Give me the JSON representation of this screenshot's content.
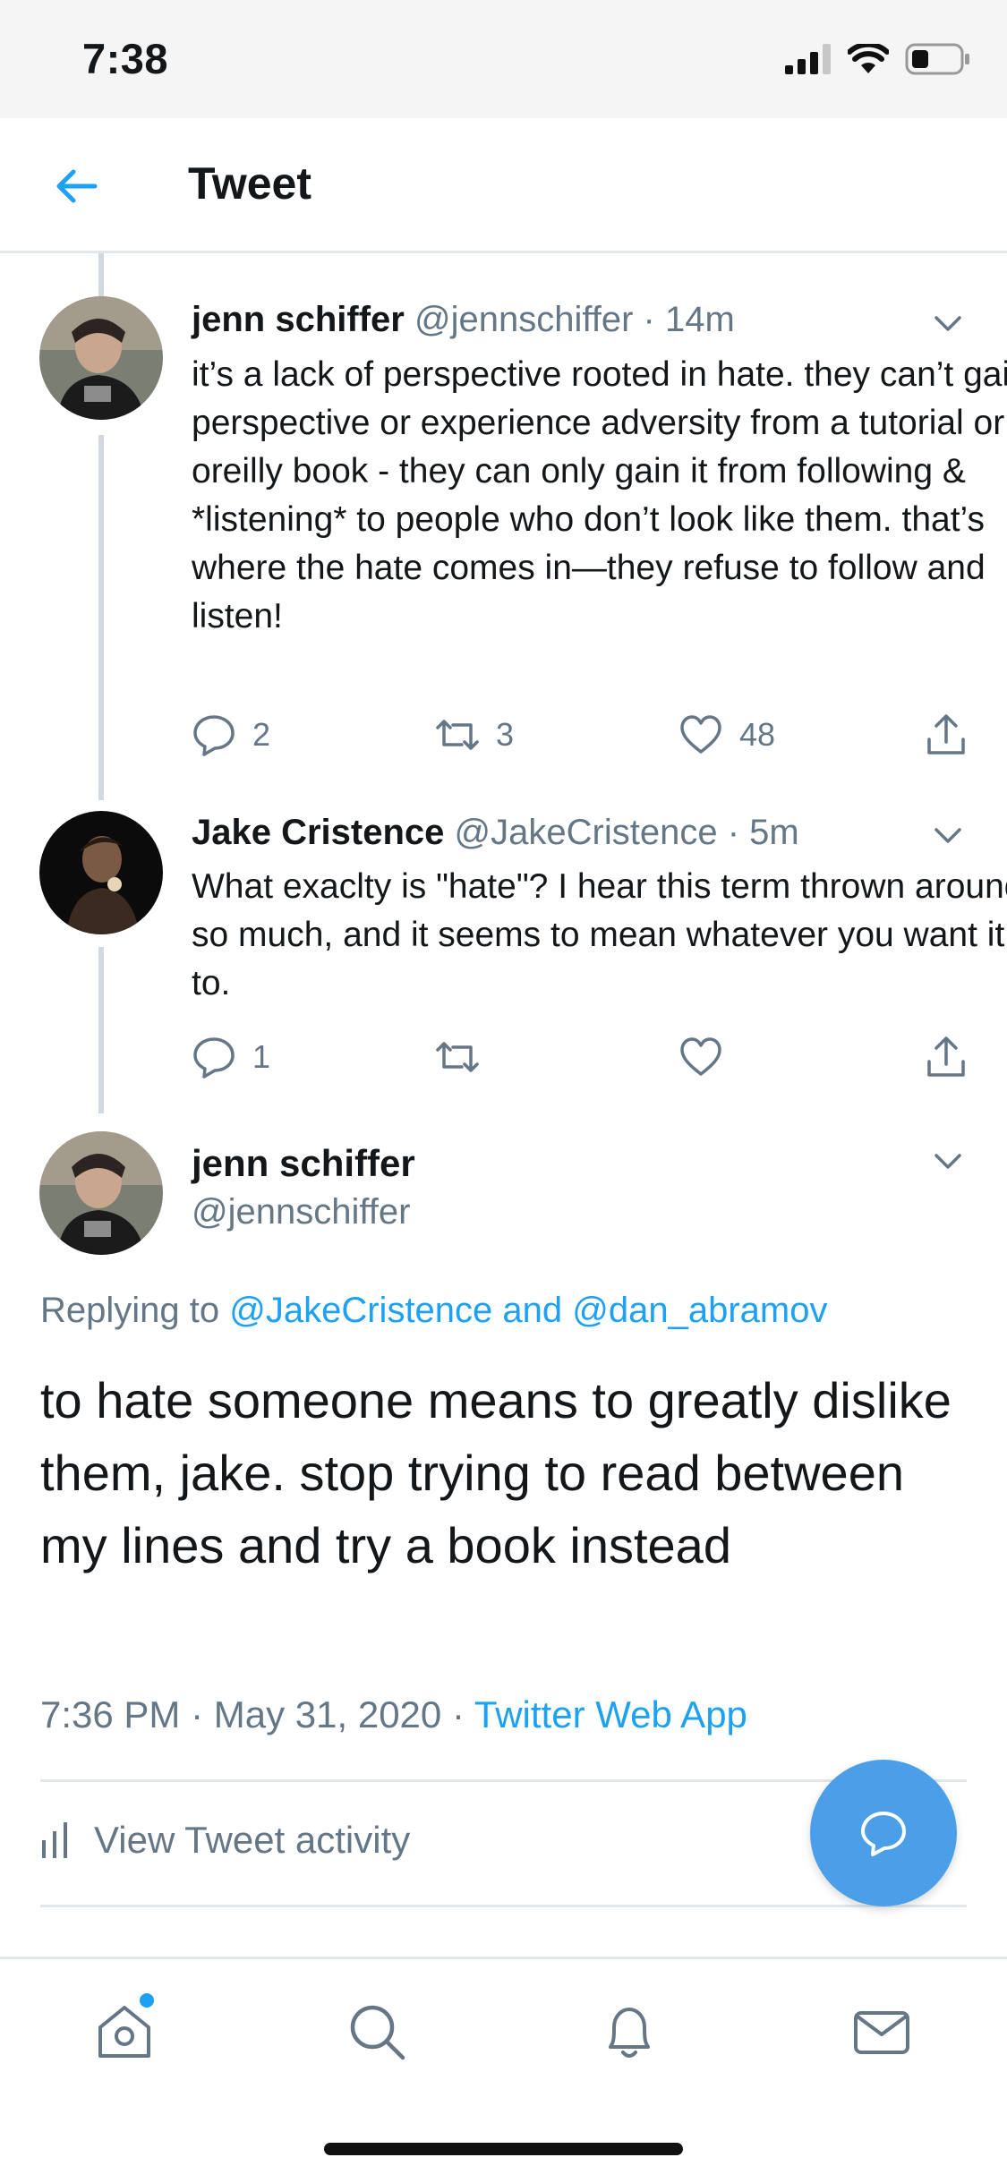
{
  "status_bar": {
    "time": "7:38"
  },
  "header": {
    "title": "Tweet"
  },
  "thread": [
    {
      "name": "jenn schiffer",
      "handle": "@jennschiffer",
      "time": "14m",
      "text": "it’s a lack of perspective rooted in hate. they can’t gain perspective or experience adversity from a tutorial or oreilly book - they can only gain it from following & *listening* to people who don’t look like them. that’s where the hate comes in—they refuse to follow and listen!",
      "replies": "2",
      "retweets": "3",
      "likes": "48"
    },
    {
      "name": "Jake Cristence",
      "handle": "@JakeCristence",
      "time": "5m",
      "text": "What exaclty is \"hate\"? I hear this term thrown around so much, and it seems to mean whatever you want it to.",
      "replies": "1",
      "retweets": "",
      "likes": ""
    }
  ],
  "main_tweet": {
    "name": "jenn schiffer",
    "handle": "@jennschiffer",
    "replying_prefix": "Replying to",
    "replying_users": "@JakeCristence and @dan_abramov",
    "text": "to hate someone means to greatly dislike them, jake. stop trying to read between my lines and try a book instead",
    "time": "7:36 PM",
    "date": "May 31, 2020",
    "source": "Twitter Web App",
    "separator": "·",
    "activity_label": "View Tweet activity"
  },
  "colors": {
    "accent": "#1da1f2",
    "fab": "#4a9fe8",
    "muted": "#657786"
  },
  "icons": [
    "back-arrow-icon",
    "chevron-down-icon",
    "reply-icon",
    "retweet-icon",
    "like-icon",
    "share-icon",
    "chart-icon",
    "compose-reply-icon",
    "home-icon",
    "search-icon",
    "notifications-icon",
    "messages-icon"
  ]
}
